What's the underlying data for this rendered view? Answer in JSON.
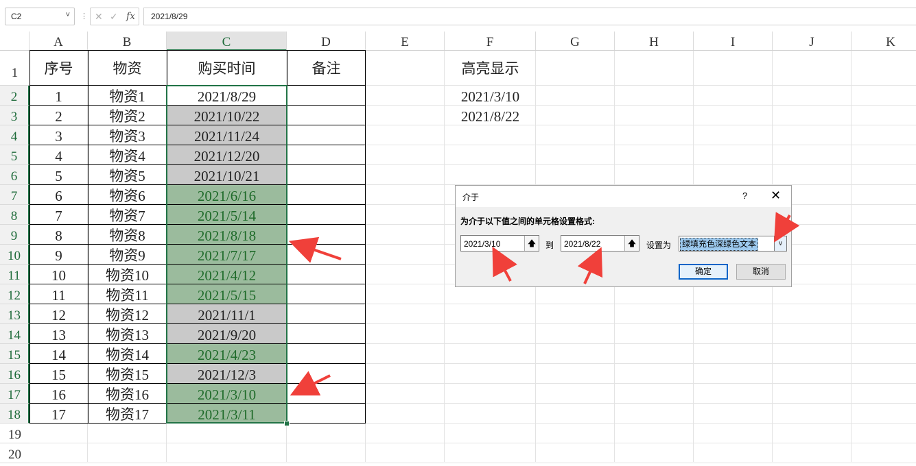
{
  "formula_bar": {
    "name_box": "C2",
    "name_box_chevron": "˅",
    "separator": "⋮",
    "cancel_glyph": "✕",
    "enter_glyph": "✓",
    "fx": "fx",
    "formula_value": "2021/8/29"
  },
  "columns": [
    "A",
    "B",
    "C",
    "D",
    "E",
    "F",
    "G",
    "H",
    "I",
    "J",
    "K"
  ],
  "rows": [
    "1",
    "2",
    "3",
    "4",
    "5",
    "6",
    "7",
    "8",
    "9",
    "10",
    "11",
    "12",
    "13",
    "14",
    "15",
    "16",
    "17",
    "18",
    "19",
    "20"
  ],
  "table": {
    "headers": [
      "序号",
      "物资",
      "购买时间",
      "备注"
    ],
    "rows": [
      {
        "no": "1",
        "item": "物资1",
        "date": "2021/8/29",
        "fill": "none"
      },
      {
        "no": "2",
        "item": "物资2",
        "date": "2021/10/22",
        "fill": "gray"
      },
      {
        "no": "3",
        "item": "物资3",
        "date": "2021/11/24",
        "fill": "gray"
      },
      {
        "no": "4",
        "item": "物资4",
        "date": "2021/12/20",
        "fill": "gray"
      },
      {
        "no": "5",
        "item": "物资5",
        "date": "2021/10/21",
        "fill": "gray"
      },
      {
        "no": "6",
        "item": "物资6",
        "date": "2021/6/16",
        "fill": "green"
      },
      {
        "no": "7",
        "item": "物资7",
        "date": "2021/5/14",
        "fill": "green"
      },
      {
        "no": "8",
        "item": "物资8",
        "date": "2021/8/18",
        "fill": "green"
      },
      {
        "no": "9",
        "item": "物资9",
        "date": "2021/7/17",
        "fill": "green"
      },
      {
        "no": "10",
        "item": "物资10",
        "date": "2021/4/12",
        "fill": "green"
      },
      {
        "no": "11",
        "item": "物资11",
        "date": "2021/5/15",
        "fill": "green"
      },
      {
        "no": "12",
        "item": "物资12",
        "date": "2021/11/1",
        "fill": "gray"
      },
      {
        "no": "13",
        "item": "物资13",
        "date": "2021/9/20",
        "fill": "gray"
      },
      {
        "no": "14",
        "item": "物资14",
        "date": "2021/4/23",
        "fill": "green"
      },
      {
        "no": "15",
        "item": "物资15",
        "date": "2021/12/3",
        "fill": "gray"
      },
      {
        "no": "16",
        "item": "物资16",
        "date": "2021/3/10",
        "fill": "green"
      },
      {
        "no": "17",
        "item": "物资17",
        "date": "2021/3/11",
        "fill": "green"
      }
    ]
  },
  "highlight": {
    "header": "高亮显示",
    "values": [
      "2021/3/10",
      "2021/8/22"
    ]
  },
  "dialog": {
    "title": "介于",
    "help": "?",
    "close": "✕",
    "prompt": "为介于以下值之间的单元格设置格式:",
    "from_value": "2021/3/10",
    "to_label": "到",
    "to_value": "2021/8/22",
    "set_as_label": "设置为",
    "format_value": "绿填充色深绿色文本",
    "picker_glyph": "🡅",
    "dropdown_glyph": "∨",
    "ok": "确定",
    "cancel": "取消"
  },
  "colors": {
    "accent_green": "#217346",
    "fill_gray": "#c9c9c9",
    "fill_green": "#9bbb9d",
    "text_green": "#1f6b2a",
    "arrow_red": "#f0403a"
  }
}
